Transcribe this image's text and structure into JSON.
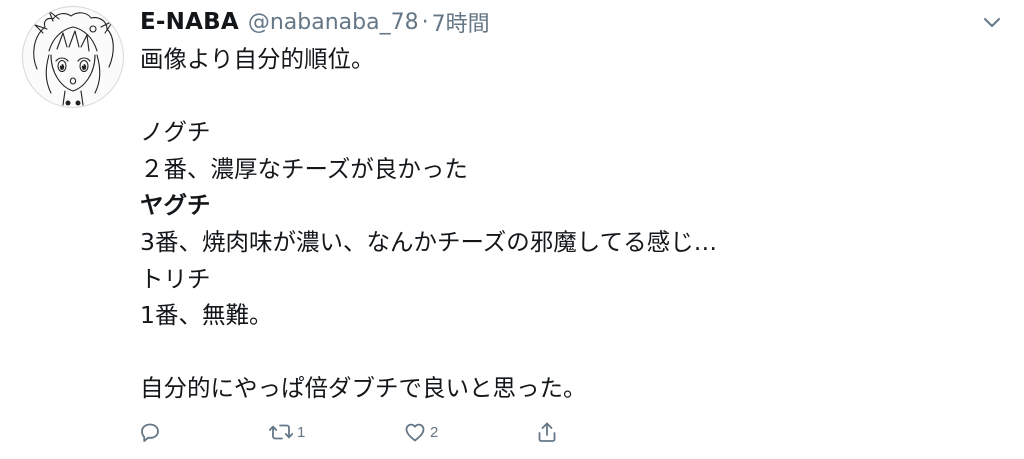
{
  "tweet": {
    "display_name": "E-NABA",
    "handle": "@nabanaba_78",
    "separator": "·",
    "timestamp": "7時間",
    "lines": [
      {
        "text": "画像より自分的順位。",
        "bold": false
      },
      {
        "text": "",
        "bold": false
      },
      {
        "text": "ノグチ",
        "bold": false
      },
      {
        "text": "２番、濃厚なチーズが良かった",
        "bold": false
      },
      {
        "text": "ヤグチ",
        "bold": true
      },
      {
        "text": "3番、焼肉味が濃い、なんかチーズの邪魔してる感じ…",
        "bold": false
      },
      {
        "text": "トリチ",
        "bold": false
      },
      {
        "text": "1番、無難。",
        "bold": false
      },
      {
        "text": "",
        "bold": false
      },
      {
        "text": "自分的にやっぱ倍ダブチで良いと思った。",
        "bold": false
      }
    ],
    "actions": {
      "reply_count": "",
      "retweet_count": "1",
      "like_count": "2"
    },
    "icons": {
      "avatar": "anime-avatar-sketch",
      "caret": "chevron-down-icon",
      "reply": "reply-icon",
      "retweet": "retweet-icon",
      "like": "heart-icon",
      "share": "share-icon"
    },
    "colors": {
      "text": "#14171a",
      "secondary": "#657786",
      "background": "#ffffff"
    }
  }
}
